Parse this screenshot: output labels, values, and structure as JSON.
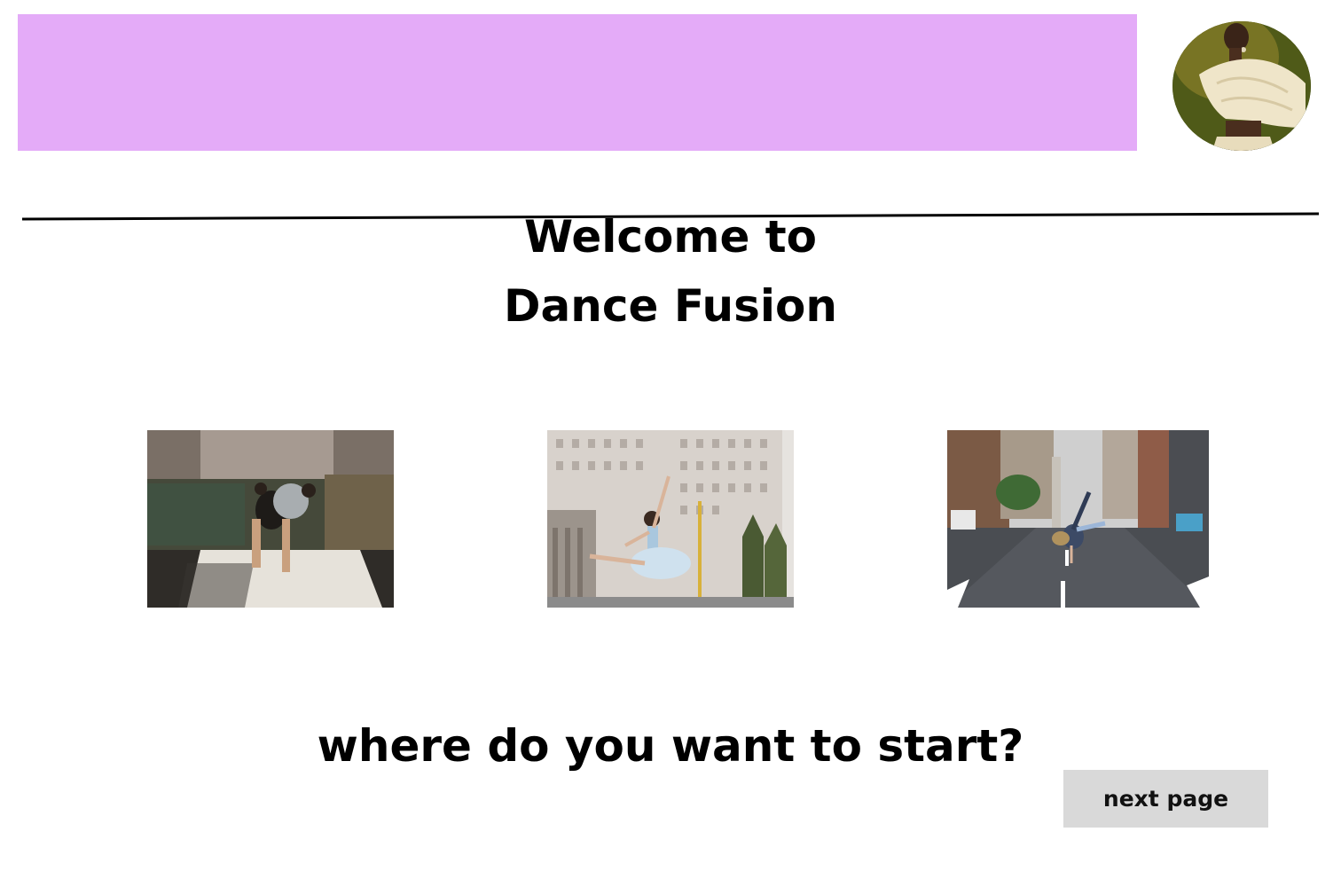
{
  "header": {
    "banner_color": "#E4ABF8",
    "avatar_icon": "dancer-portrait-image"
  },
  "hero": {
    "title_line1": "Welcome to",
    "title_line2": "Dance Fusion"
  },
  "gallery": {
    "items": [
      {
        "icon": "contemporary-dance-duo-photo"
      },
      {
        "icon": "ballet-dancer-photo"
      },
      {
        "icon": "street-dance-handstand-photo"
      }
    ]
  },
  "prompt": {
    "text": "where do you want to start?"
  },
  "actions": {
    "next_label": "next page",
    "next_bg": "#D9D9D9"
  }
}
